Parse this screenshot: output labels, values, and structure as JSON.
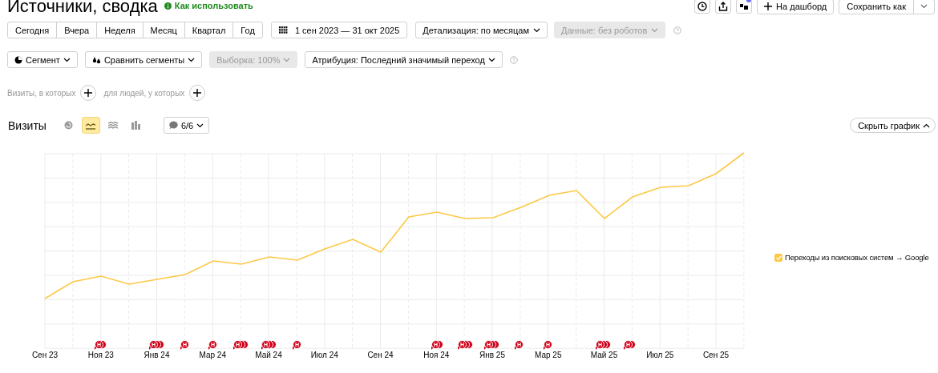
{
  "header": {
    "title": "Источники, сводка",
    "help_link": "Как использовать",
    "dashboard_button": "На дашборд",
    "save_button": "Сохранить как"
  },
  "period_tabs": [
    {
      "label": "Сегодня",
      "selected": false
    },
    {
      "label": "Вчера",
      "selected": false
    },
    {
      "label": "Неделя",
      "selected": false
    },
    {
      "label": "Месяц",
      "selected": false
    },
    {
      "label": "Квартал",
      "selected": false
    },
    {
      "label": "Год",
      "selected": false
    }
  ],
  "date_range": "1 сен 2023 — 31 окт 2025",
  "row1_dropdowns": [
    {
      "label": "Детализация: по месяцам",
      "disabled": false
    },
    {
      "label": "Данные: без роботов",
      "disabled": true
    }
  ],
  "row2_dropdowns": [
    {
      "kind": "segment",
      "label": "Сегмент",
      "disabled": false
    },
    {
      "kind": "compare",
      "label": "Сравнить сегменты",
      "disabled": false
    },
    {
      "kind": "plain",
      "label": "Выборка: 100%",
      "disabled": true
    },
    {
      "kind": "plain",
      "label": "Атрибуция: Последний значимый переход",
      "disabled": false
    }
  ],
  "filters": [
    {
      "label": "Визиты, в которых"
    },
    {
      "label": "для людей, у которых"
    }
  ],
  "chart_header": {
    "title": "Визиты",
    "chart_types": [
      {
        "kind": "pie",
        "selected": false
      },
      {
        "kind": "line",
        "selected": true
      },
      {
        "kind": "area",
        "selected": false
      },
      {
        "kind": "bar",
        "selected": false
      }
    ],
    "notes_toggle": "6/6",
    "hide_button": "Скрыть график"
  },
  "chart": {
    "x_labels": [
      "Сен 23",
      "Ноя 23",
      "Янв 24",
      "Мар 24",
      "Май 24",
      "Июл 24",
      "Сен 24",
      "Ноя 24",
      "Янв 25",
      "Мар 25",
      "Май 25",
      "Июл 25",
      "Сен 25"
    ],
    "markers": [
      {
        "label": "Н"
      },
      {
        "label": "Н"
      },
      {
        "label": "Н"
      },
      {
        "label": "Н"
      },
      {
        "label": "Н"
      },
      {
        "label": "Н"
      },
      {
        "label": "Н"
      },
      {
        "label": "Н"
      },
      {
        "label": "Н"
      },
      {
        "label": "Н"
      },
      {
        "label": "Н"
      },
      {
        "label": "Н"
      },
      {
        "label": "Н"
      },
      {
        "label": "Н"
      }
    ],
    "legend": [
      {
        "label": "Переходы из поисковых систем → Google",
        "checked": true,
        "color": "#fdc844"
      }
    ]
  }
}
